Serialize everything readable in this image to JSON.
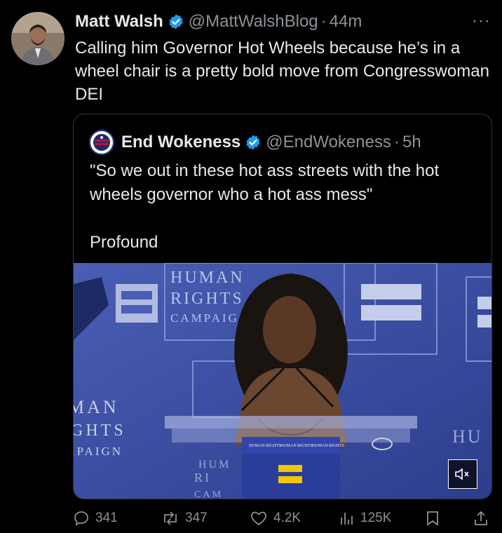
{
  "tweet": {
    "author_name": "Matt Walsh",
    "author_handle": "@MattWalshBlog",
    "separator": "·",
    "time": "44m",
    "more_label": "···",
    "text": "Calling him Governor Hot Wheels because he’s in a wheel chair is a pretty bold move from Congresswoman DEI"
  },
  "quote": {
    "author_name": "End Wokeness",
    "author_handle": "@EndWokeness",
    "separator": "·",
    "time": "5h",
    "text_line1": "\"So we out in these hot ass streets with the hot wheels governor who a hot ass mess\"",
    "text_line2": "Profound",
    "video": {
      "backdrop_text_1": "HUMAN",
      "backdrop_text_2": "RIGHTS",
      "backdrop_text_3": "CAMPAIG",
      "left_text_1": "MAN",
      "left_text_2": "GHTS",
      "left_text_3": "IPAIGN",
      "right_text": "HU",
      "podium_text_1": "HUMAN RIGHTS",
      "podium_text_2": "HUMAN RIGHTS",
      "podium_text_3": "HUMAN RIGHTS",
      "bottom_text_1": "HUM",
      "bottom_text_2": "RI",
      "bottom_text_3": "CAM"
    }
  },
  "actions": {
    "replies": "341",
    "reposts": "347",
    "likes": "4.2K",
    "views": "125K"
  },
  "icons": [
    "verified-icon",
    "more-icon",
    "reply-icon",
    "repost-icon",
    "like-icon",
    "views-icon",
    "bookmark-icon",
    "share-icon",
    "mute-icon"
  ],
  "colors": {
    "background": "#000000",
    "text": "#e7e9ea",
    "muted": "#8b9298",
    "verified": "#1d9bf0",
    "border": "#333639",
    "stage_blue": "#3b4fa3"
  }
}
